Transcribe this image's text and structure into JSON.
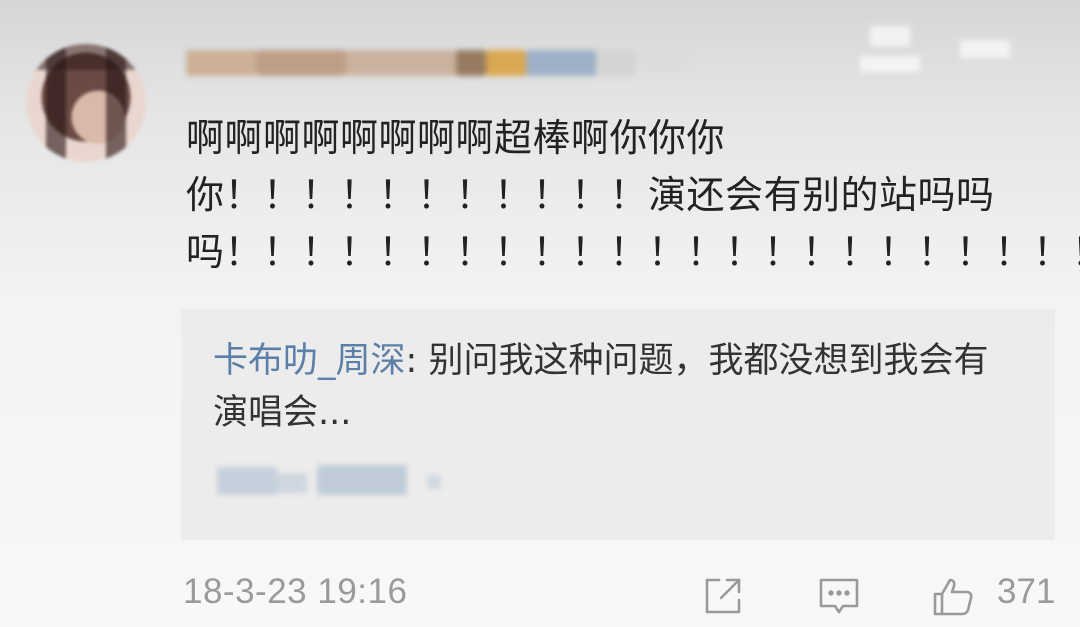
{
  "comment": {
    "lines": [
      "啊啊啊啊啊啊啊啊超棒啊你你你",
      "你！！！！！！！！！！！演还会有别的站吗吗",
      "吗！！！！！！！！！！！！！！！！！！！！！！！"
    ]
  },
  "reply": {
    "username": "卡布叻_周深",
    "separator": ": ",
    "text": "别问我这种问题，我都没想到我会有演唱会..."
  },
  "footer": {
    "timestamp": "18-3-23 19:16",
    "share_icon": "share-icon",
    "comment_icon": "comment-icon",
    "like_icon": "thumbs-up-icon",
    "like_count": "371"
  },
  "colors": {
    "text": "#222222",
    "reply_user": "#5b7fa6",
    "meta": "#9a9a9a",
    "reply_bg": "#ececec"
  }
}
